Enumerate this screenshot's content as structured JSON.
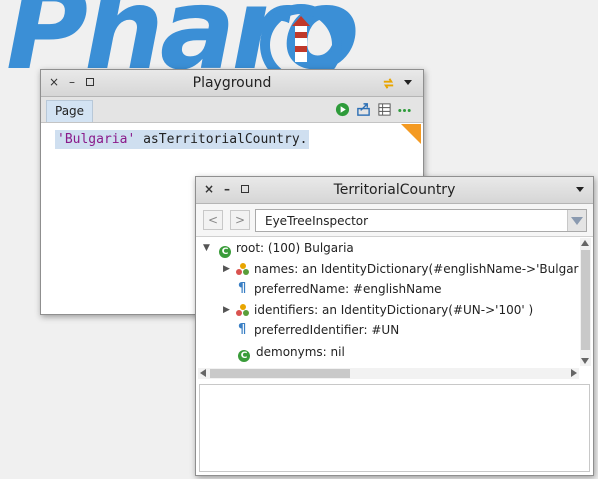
{
  "logo": {
    "text": "Pharo"
  },
  "playground": {
    "title": "Playground",
    "tabs": [
      {
        "label": "Page"
      }
    ],
    "toolbar_icons": [
      "run-icon",
      "publish-icon",
      "bindings-icon",
      "more-icon"
    ],
    "code": {
      "string_literal": "'Bulgaria'",
      "message": " asTerritorialCountry."
    }
  },
  "inspector": {
    "title": "TerritorialCountry",
    "nav": {
      "back": "<",
      "forward": ">"
    },
    "view_selector": {
      "selected": "EyeTreeInspector"
    },
    "tree": [
      {
        "label": "root: (100) Bulgaria",
        "icon": "class-icon",
        "expanded": true,
        "depth": 0
      },
      {
        "label": "names: an IdentityDictionary(#englishName->'Bulgaria' )",
        "icon": "dictionary-icon",
        "expanded": false,
        "depth": 1
      },
      {
        "label": "preferredName: #englishName",
        "icon": "symbol-icon",
        "depth": 1
      },
      {
        "label": "identifiers: an IdentityDictionary(#UN->'100' )",
        "icon": "dictionary-icon",
        "expanded": false,
        "depth": 1
      },
      {
        "label": "preferredIdentifier: #UN",
        "icon": "symbol-icon",
        "depth": 1
      },
      {
        "label": "demonyms: nil",
        "icon": "class-icon",
        "depth": 1
      }
    ]
  },
  "colors": {
    "logo_blue": "#3b8fd6",
    "selection": "#cfdff0",
    "string_literal": "#8a1a8a",
    "class_icon": "#3a9c3a",
    "corner_marker": "#f49a22"
  }
}
